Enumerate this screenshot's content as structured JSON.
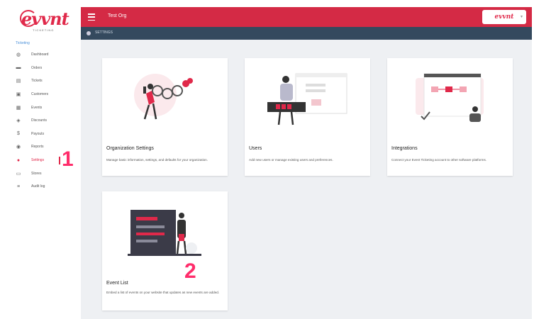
{
  "sidebar": {
    "logo_text": "evvnt",
    "logo_subtext": "TICKETING",
    "heading": "Ticketing",
    "items": [
      {
        "label": "Dashboard",
        "icon": "dashboard-icon",
        "glyph": "◍"
      },
      {
        "label": "Orders",
        "icon": "orders-icon",
        "glyph": "▬"
      },
      {
        "label": "Tickets",
        "icon": "tickets-icon",
        "glyph": "▤"
      },
      {
        "label": "Customers",
        "icon": "customers-icon",
        "glyph": "▣"
      },
      {
        "label": "Events",
        "icon": "events-icon",
        "glyph": "▦"
      },
      {
        "label": "Discounts",
        "icon": "discounts-icon",
        "glyph": "◈"
      },
      {
        "label": "Payouts",
        "icon": "payouts-icon",
        "glyph": "$"
      },
      {
        "label": "Reports",
        "icon": "reports-icon",
        "glyph": "◉"
      },
      {
        "label": "Settings",
        "icon": "settings-icon",
        "glyph": "●",
        "active": true
      },
      {
        "label": "Stores",
        "icon": "stores-icon",
        "glyph": "▭"
      },
      {
        "label": "Audit log",
        "icon": "audit-log-icon",
        "glyph": "≡"
      }
    ]
  },
  "annotations": {
    "marker_1": "1",
    "marker_2": "2"
  },
  "header": {
    "org_title": "Test Org",
    "brand_button_text": "evvnt",
    "menu_icon": "hamburger-menu-icon"
  },
  "subbar": {
    "label": "SETTINGS"
  },
  "cards": {
    "org": {
      "title": "Organization Settings",
      "description": "Manage basic information, settings, and defaults for your organization."
    },
    "users": {
      "title": "Users",
      "description": "Add new users or manage existing users and preferences."
    },
    "integrations": {
      "title": "Integrations",
      "description": "Connect your Event Ticketing account to other software platforms."
    },
    "eventlist": {
      "title": "Event List",
      "description": "Embed a list of events on your website that updates as new events are added."
    }
  },
  "colors": {
    "accent": "#d42a45",
    "subbar": "#34495e",
    "background": "#eef0f3",
    "marker": "#ff2d6b"
  }
}
